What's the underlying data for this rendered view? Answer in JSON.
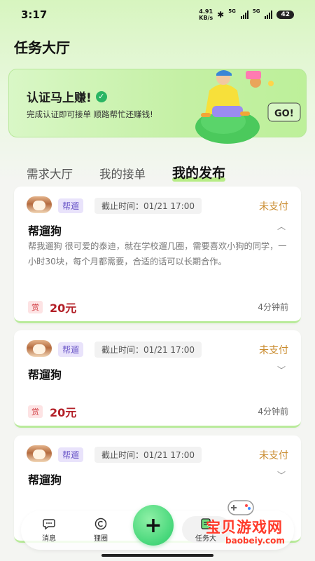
{
  "status_bar": {
    "time": "3:17",
    "net_speed_value": "4.91",
    "net_speed_unit": "KB/s",
    "sim1": "5G",
    "sim2": "5G",
    "battery": "42"
  },
  "page": {
    "title": "任务大厅"
  },
  "banner": {
    "title": "认证马上赚!",
    "subtitle": "完成认证即可接单 顺路帮忙还赚钱!",
    "sign_text": "GO!"
  },
  "tabs": [
    {
      "label": "需求大厅",
      "active": false
    },
    {
      "label": "我的接单",
      "active": false
    },
    {
      "label": "我的发布",
      "active": true
    }
  ],
  "cards": [
    {
      "tag": "帮遛",
      "deadline": "截止时间：01/21 17:00",
      "status": "未支付",
      "title": "帮遛狗",
      "description": "帮我遛狗 很可爱的泰迪，就在学校遛几圈，需要喜欢小狗的同学，一小时30块，每个月都需要，合适的话可以长期合作。",
      "reward_badge": "赏",
      "amount": "20元",
      "time_ago": "4分钟前",
      "expanded": true
    },
    {
      "tag": "帮遛",
      "deadline": "截止时间：01/21 17:00",
      "status": "未支付",
      "title": "帮遛狗",
      "reward_badge": "赏",
      "amount": "20元",
      "time_ago": "4分钟前",
      "expanded": false
    },
    {
      "tag": "帮遛",
      "deadline": "截止时间：01/21 17:00",
      "status": "未支付",
      "title": "帮遛狗",
      "expanded": false
    }
  ],
  "bottom_nav": {
    "items": [
      {
        "label": "消息",
        "icon": "chat-bubble-icon"
      },
      {
        "label": "狸圈",
        "icon": "circle-c-icon"
      },
      {
        "label": "任务大",
        "icon": "task-icon"
      }
    ],
    "fab_label": "+"
  },
  "watermark": {
    "text": "宝贝游戏网",
    "url": "baobeiy.com"
  },
  "colors": {
    "accent_green": "#46d77a",
    "status_orange": "#c98a2b",
    "reward_red": "#b32028",
    "tag_purple": "#6c58c8"
  }
}
